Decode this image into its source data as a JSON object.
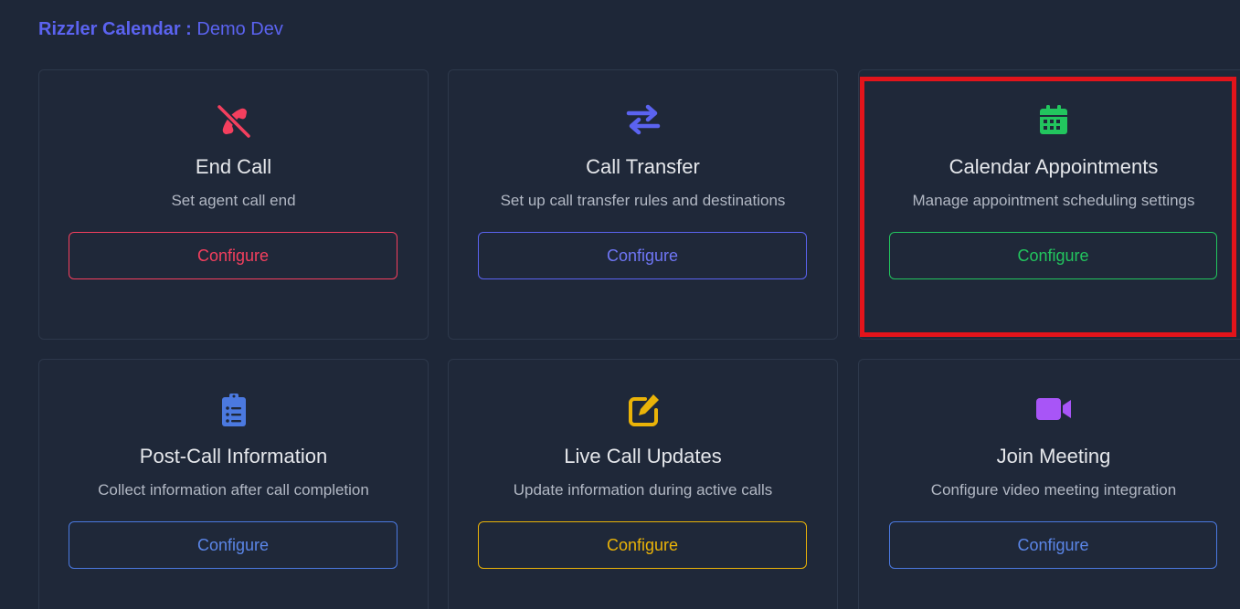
{
  "header": {
    "app_name": "Rizzler Calendar",
    "separator": " : ",
    "workspace": "Demo Dev"
  },
  "cards": [
    {
      "title": "End Call",
      "description": "Set agent call end",
      "button_label": "Configure",
      "icon": "phone-slash-icon",
      "accent": "#f43f5e"
    },
    {
      "title": "Call Transfer",
      "description": "Set up call transfer rules and destinations",
      "button_label": "Configure",
      "icon": "arrows-transfer-icon",
      "accent": "#5b63f0"
    },
    {
      "title": "Calendar Appointments",
      "description": "Manage appointment scheduling settings",
      "button_label": "Configure",
      "icon": "calendar-icon",
      "accent": "#22c55e"
    },
    {
      "title": "Post-Call Information",
      "description": "Collect information after call completion",
      "button_label": "Configure",
      "icon": "clipboard-list-icon",
      "accent": "#4b79e0"
    },
    {
      "title": "Live Call Updates",
      "description": "Update information during active calls",
      "button_label": "Configure",
      "icon": "edit-icon",
      "accent": "#eab308"
    },
    {
      "title": "Join Meeting",
      "description": "Configure video meeting integration",
      "button_label": "Configure",
      "icon": "video-camera-icon",
      "accent": "#a855f7"
    }
  ],
  "highlight_color": "#e3141b"
}
